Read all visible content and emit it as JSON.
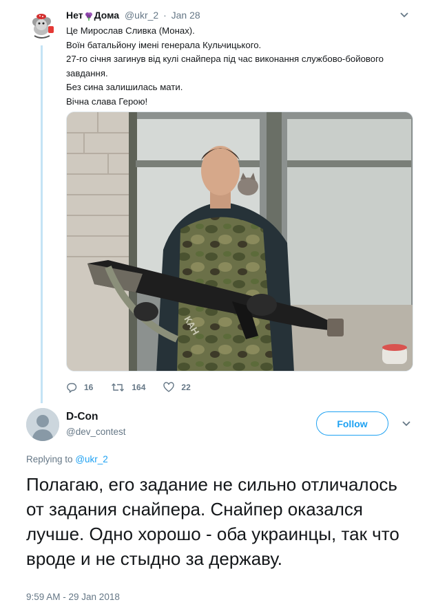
{
  "tweet": {
    "author_name_part1": "Нет",
    "author_name_part2": "Дома",
    "handle": "@ukr_2",
    "separator": "·",
    "date": "Jan 28",
    "lines": [
      "Це Мирослав Сливка (Монах).",
      "Воїн батальйону імені генерала Кульчицького.",
      "27-го січня загинув від кулі снайпера під час виконання службово-бойового завдання.",
      "Без сина залишилась мати.",
      "Вічна слава Герою!"
    ],
    "photo_patch_text": "КАН",
    "stats": {
      "replies": "16",
      "retweets": "164",
      "likes": "22"
    }
  },
  "reply": {
    "author_name": "D-Con",
    "handle": "@dev_contest",
    "follow_label": "Follow",
    "replying_to_label": "Replying to",
    "replying_to_handle": "@ukr_2",
    "text": "Полагаю, его задание не сильно отличалось от задания снайпера. Снайпер оказался лучше. Одно хорошо - оба украинцы, так что вроде и не стыдно за державу.",
    "timestamp": "9:59 AM - 29 Jan 2018"
  },
  "icons": {
    "reply": "reply-icon",
    "retweet": "retweet-icon",
    "like": "heart-icon",
    "caret": "chevron-down-icon"
  },
  "colors": {
    "accent": "#1da1f2",
    "muted": "#657786",
    "thread_line": "#c4e3f5"
  }
}
